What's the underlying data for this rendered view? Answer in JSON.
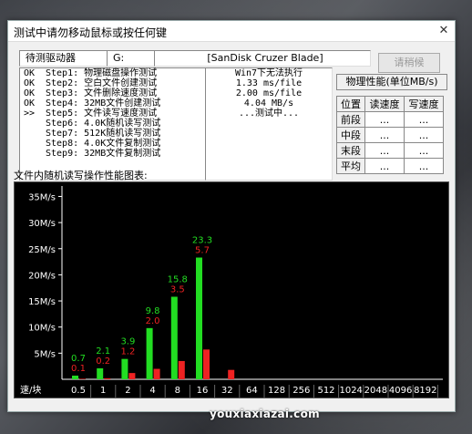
{
  "window": {
    "title": "测试中请勿移动鼠标或按任何键",
    "close_glyph": "✕"
  },
  "header": {
    "drive_label": "待测驱动器",
    "drive_letter": "G:",
    "device_name": "[SanDisk Cruzer Blade]",
    "test_button": "请稍候"
  },
  "steps": [
    {
      "status": "OK",
      "label": "Step1: 物理磁盘操作测试"
    },
    {
      "status": "OK",
      "label": "Step2: 空白文件创建测试"
    },
    {
      "status": "OK",
      "label": "Step3: 文件删除速度测试"
    },
    {
      "status": "OK",
      "label": "Step4: 32MB文件创建测试"
    },
    {
      "status": ">>",
      "label": "Step5: 文件读写速度测试"
    },
    {
      "status": "",
      "label": "Step6: 4.0K随机读写测试"
    },
    {
      "status": "",
      "label": "Step7: 512K随机读写测试"
    },
    {
      "status": "",
      "label": "Step8: 4.0K文件复制测试"
    },
    {
      "status": "",
      "label": "Step9: 32MB文件复制测试"
    }
  ],
  "results": [
    "Win7下无法执行",
    "1.33 ms/file",
    "2.00 ms/file",
    "4.04 MB/s",
    "...测试中..."
  ],
  "perf": {
    "title": "物理性能(单位MB/s)",
    "headers": [
      "位置",
      "读速度",
      "写速度"
    ],
    "rows": [
      {
        "pos": "前段",
        "read": "...",
        "write": "..."
      },
      {
        "pos": "中段",
        "read": "...",
        "write": "..."
      },
      {
        "pos": "末段",
        "read": "...",
        "write": "..."
      },
      {
        "pos": "平均",
        "read": "...",
        "write": "..."
      }
    ]
  },
  "chart_label": "文件内随机读写操作性能图表:",
  "chart_data": {
    "type": "bar",
    "categories": [
      "0.5",
      "1",
      "2",
      "4",
      "8",
      "16",
      "32",
      "64",
      "128",
      "256",
      "512",
      "1024",
      "2048",
      "4096",
      "8192"
    ],
    "x_axis_label": "速/块",
    "y_ticks": [
      "35M/s",
      "30M/s",
      "25M/s",
      "20M/s",
      "15M/s",
      "10M/s",
      "5M/s"
    ],
    "ylim": [
      0,
      37
    ],
    "series": [
      {
        "color": "#22dd22",
        "values": [
          0.7,
          2.1,
          3.9,
          9.8,
          15.8,
          23.3,
          null,
          null,
          null,
          null,
          null,
          null,
          null,
          null,
          null
        ]
      },
      {
        "color": "#ee2222",
        "values": [
          0.1,
          0.2,
          1.2,
          2.0,
          3.5,
          5.7,
          1.8,
          null,
          null,
          null,
          null,
          null,
          null,
          null,
          null
        ]
      }
    ],
    "data_labels": {
      "green": [
        "0.7",
        "2.1",
        "3.9",
        "9.8",
        "15.8",
        "23.3"
      ],
      "red": [
        "0.1",
        "0.2",
        "1.2",
        "2.0",
        "3.5",
        "5.7"
      ]
    }
  },
  "watermark": "youxiaxiazai.com"
}
